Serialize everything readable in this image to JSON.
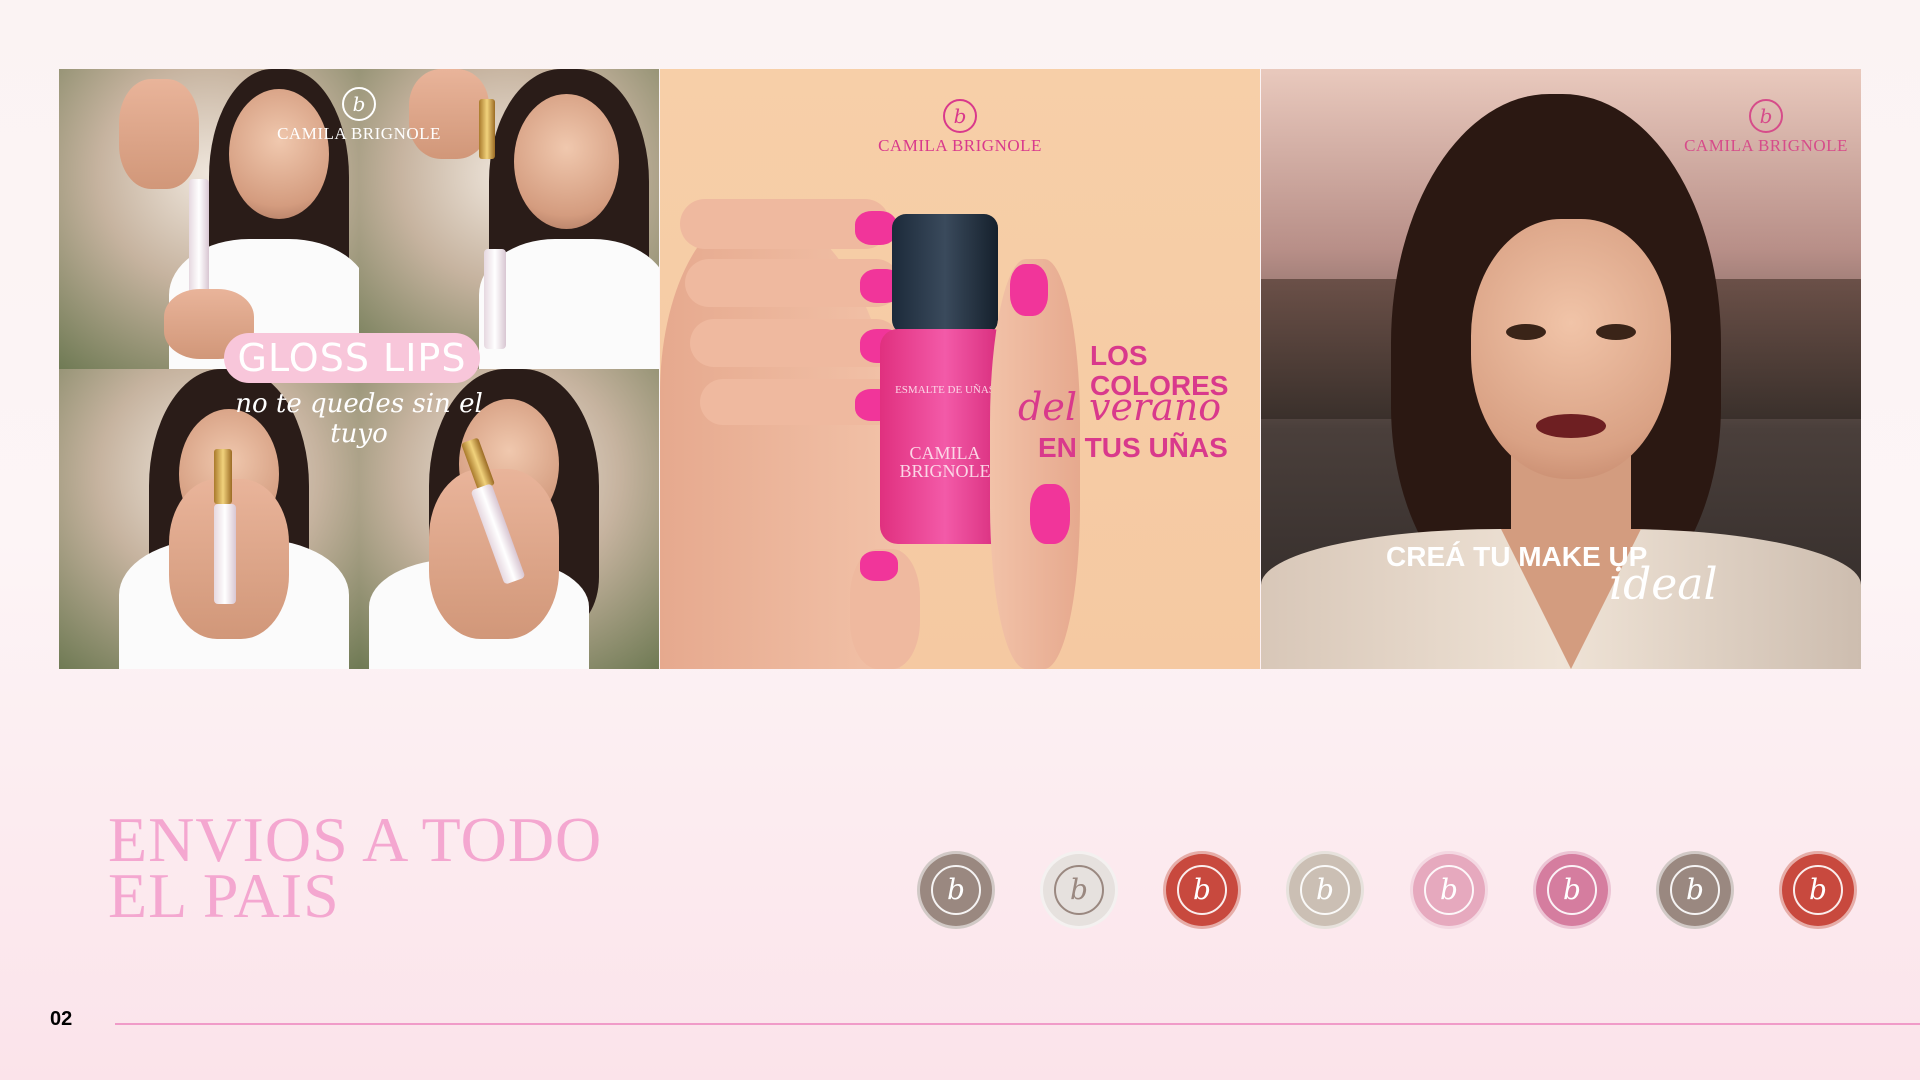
{
  "brand": "CAMILA BRIGNOLE",
  "panel1": {
    "title": "GLOSS LIPS",
    "subtitle": "no te quedes sin el tuyo"
  },
  "panel2": {
    "line1": "LOS",
    "line2": "COLORES",
    "script": "del verano",
    "line3": "EN TUS UÑAS",
    "bottle_label1": "ESMALTE DE UÑAS",
    "bottle_label2": "CAMILA BRIGNOLE"
  },
  "panel3": {
    "line": "CREÁ TU MAKE UP",
    "script": "ideal"
  },
  "headline": {
    "line1": "ENVIOS A TODO",
    "line2": "EL PAIS"
  },
  "swatches": [
    "#9a8880",
    "#e6e1de",
    "#c8493e",
    "#cbbfb4",
    "#e6a9be",
    "#d57d9f",
    "#9a8880",
    "#c8493e"
  ],
  "page_number": "02",
  "colors": {
    "accent": "#f4a7d0",
    "nail_pink": "#d9398c",
    "line": "#f09bc8"
  }
}
